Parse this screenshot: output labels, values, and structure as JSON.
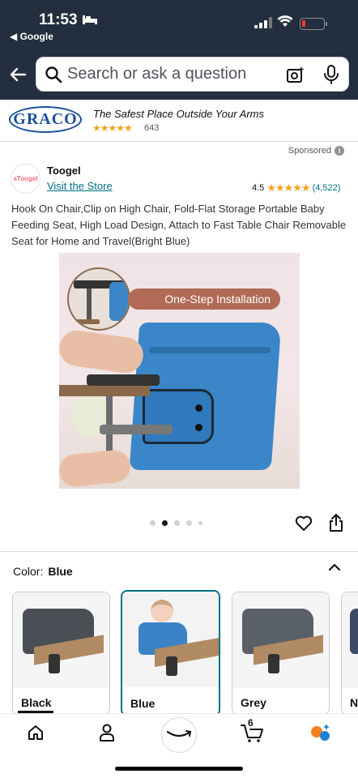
{
  "status_bar": {
    "time": "11:53",
    "back_app": "◀ Google"
  },
  "search": {
    "placeholder": "Search or ask a question"
  },
  "banner": {
    "logo_text": "GRACO",
    "tagline": "The Safest Place Outside Your Arms",
    "stars": "★★★★★",
    "rating_count": "643"
  },
  "sponsored": {
    "label": "Sponsored",
    "info_icon": "i"
  },
  "store": {
    "logo_text": "sToogel",
    "name": "Toogel",
    "visit_link": "Visit the Store",
    "rating": "4.5",
    "stars": "★★★★★",
    "review_count": "(4,522)"
  },
  "product": {
    "title": "Hook On Chair,Clip on High Chair, Fold-Flat Storage Portable Baby Feeding Seat, High Load Design, Attach to Fast Table Chair Removable Seat for Home and Travel(Bright Blue)",
    "image_caption": "One-Step Installation",
    "image_count": 5,
    "active_image_index": 1
  },
  "color": {
    "label": "Color:",
    "selected": "Blue",
    "options": [
      {
        "label": "Black"
      },
      {
        "label": "Blue"
      },
      {
        "label": "Grey"
      },
      {
        "label": "N"
      }
    ]
  },
  "bottom_nav": {
    "cart_count": "6"
  },
  "icons": [
    "back-arrow-icon",
    "search-icon",
    "camera-icon",
    "mic-icon",
    "heart-icon",
    "share-icon",
    "chevron-up-icon",
    "home-icon",
    "account-icon",
    "alexa-icon",
    "cart-icon",
    "menu-icon"
  ],
  "colors": {
    "header_bg": "#232f3e",
    "link": "#007185",
    "star": "#f5a31a",
    "selected_border": "#007185"
  }
}
